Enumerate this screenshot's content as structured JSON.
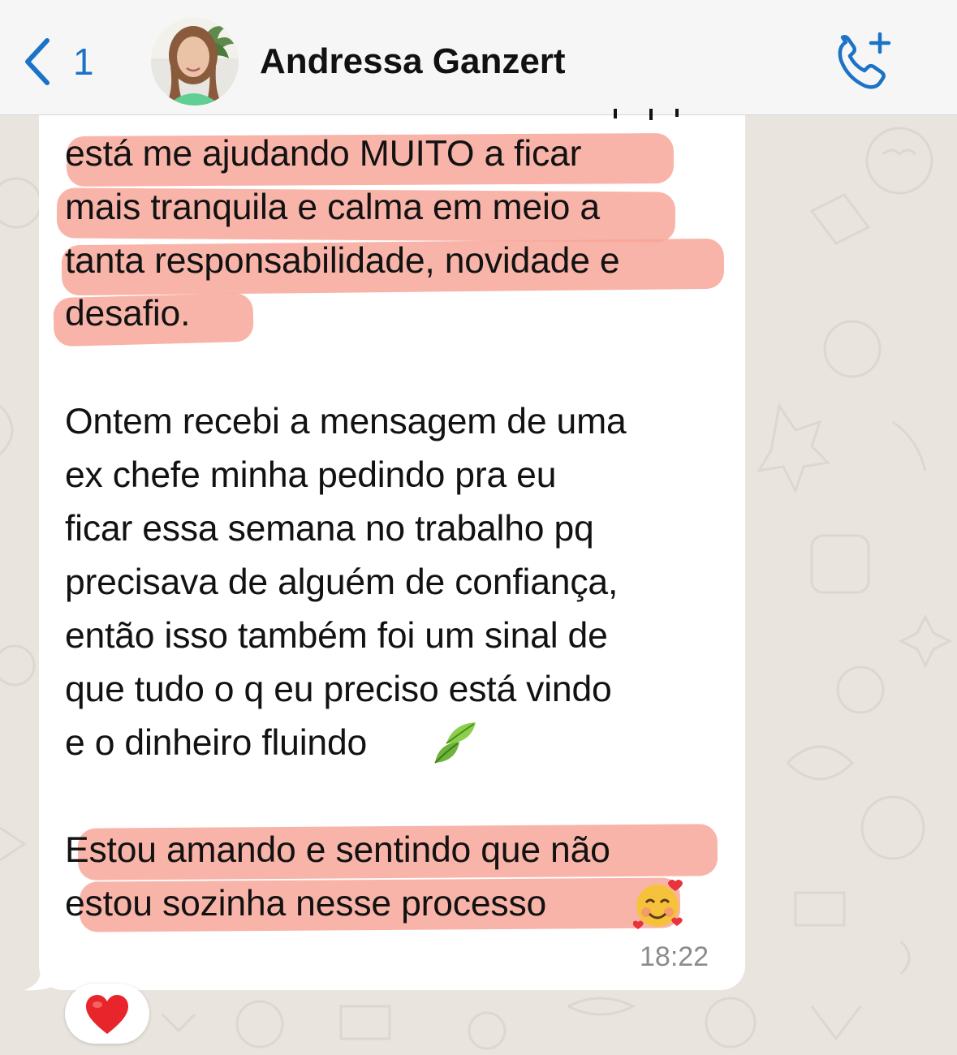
{
  "header": {
    "unread_count": "1",
    "contact_name": "Andressa Ganzert",
    "accent_color": "#1a73c7"
  },
  "message": {
    "lines": [
      "está me ajudando MUITO a ficar",
      "mais tranquila e calma em meio a",
      "tanta responsabilidade, novidade e",
      "desafio.",
      "Ontem recebi a mensagem de uma",
      "ex chefe minha pedindo pra eu",
      "ficar essa semana no trabalho pq",
      "precisava de alguém de confiança,",
      "então isso também foi um sinal de",
      "que tudo o q eu preciso está vindo",
      "e o dinheiro fluindo",
      "Estou amando e sentindo que não",
      "estou sozinha nesse processo"
    ],
    "timestamp": "18:22",
    "highlight_color": "#f8a396",
    "emojis": [
      "leaves-emoji",
      "smiling-face-with-hearts-emoji"
    ]
  },
  "reaction": {
    "emoji": "red-heart-emoji"
  },
  "icons": [
    "chevron-left-icon",
    "avatar-photo",
    "add-call-icon",
    "red-heart-icon"
  ]
}
